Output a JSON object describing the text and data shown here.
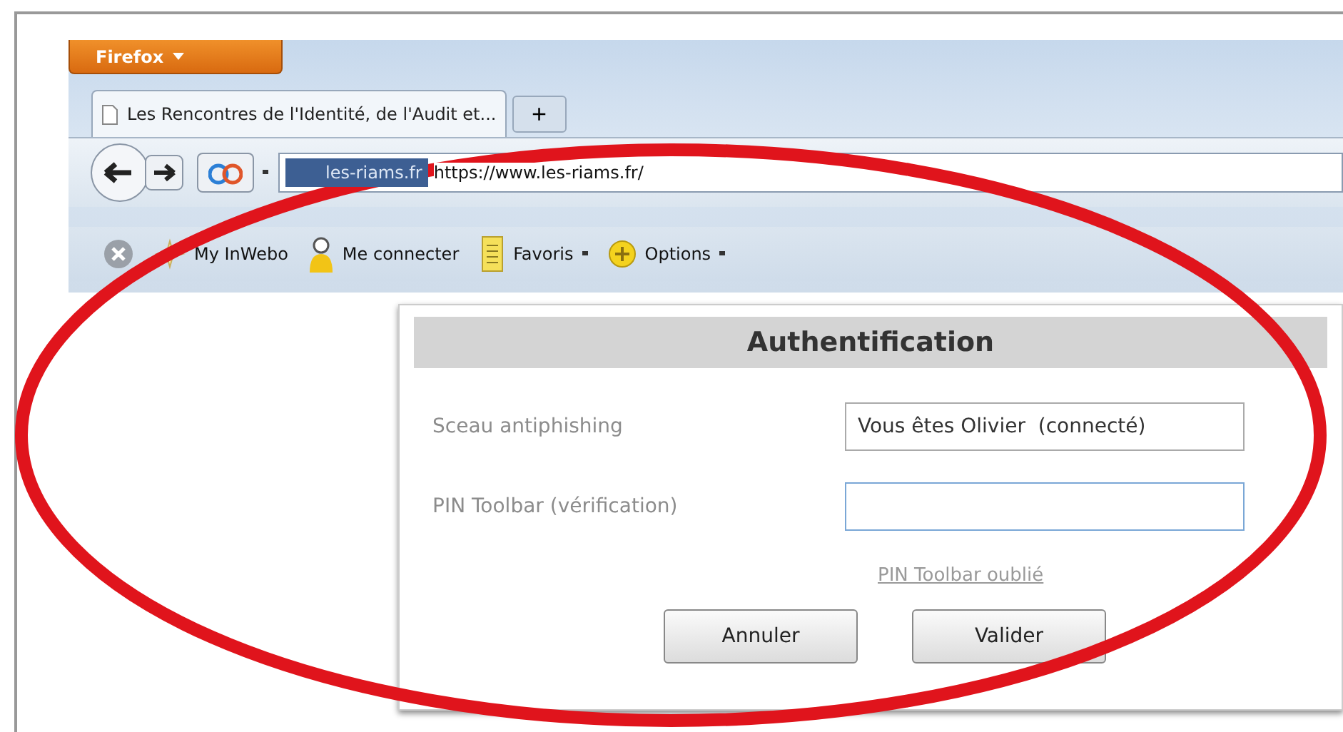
{
  "browser": {
    "menu_button": "Firefox",
    "tabs": [
      {
        "label": "Les Rencontres de l'Identité, de l'Audit et...",
        "selected": true
      }
    ],
    "new_tab": "+",
    "site_identity": "les-riams.fr",
    "url": "https://www.les-riams.fr/",
    "toolbar": [
      {
        "label": "My InWebo",
        "kind": "star",
        "dropdown": false
      },
      {
        "label": "Me connecter",
        "kind": "person",
        "dropdown": false
      },
      {
        "label": "Favoris",
        "kind": "notepad",
        "dropdown": true
      },
      {
        "label": "Options",
        "kind": "plus",
        "dropdown": true
      }
    ]
  },
  "dialog": {
    "title": "Authentification",
    "fields": [
      {
        "label": "Sceau antiphishing",
        "value": "Vous êtes Olivier  (connecté)",
        "focused": false
      },
      {
        "label": "PIN Toolbar (vérification)",
        "focused": true
      }
    ],
    "link": "PIN Toolbar oublié",
    "buttons": [
      "Annuler",
      "Valider"
    ]
  }
}
